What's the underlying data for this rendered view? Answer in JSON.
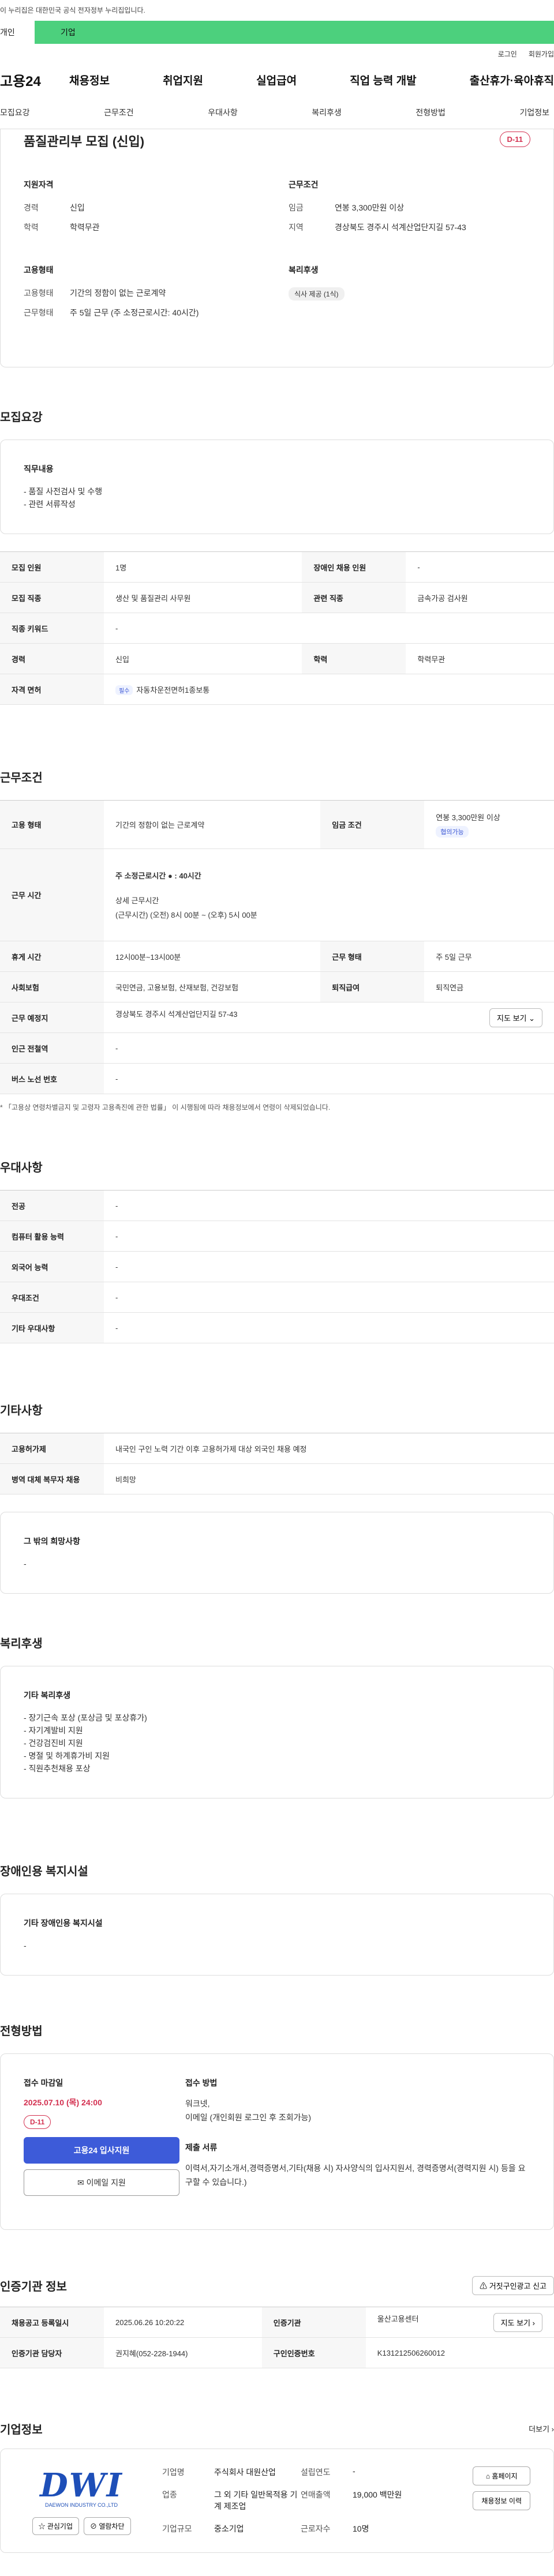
{
  "gov_banner": "이 누리집은 대한민국 공식 전자정부 누리집입니다.",
  "top_tabs": {
    "person": "개인",
    "company": "기업"
  },
  "util": {
    "login": "로그인",
    "signup": "회원가입"
  },
  "gnb": {
    "logo": "고용24",
    "menu": [
      "채용정보",
      "취업지원",
      "실업급여",
      "직업 능력 개발",
      "출산휴가·육아휴직"
    ]
  },
  "subnav": [
    "모집요강",
    "근무조건",
    "우대사항",
    "복리후생",
    "전형방법",
    "기업정보"
  ],
  "job": {
    "title": "품질관리부 모집 (신입)",
    "dday": "D-11",
    "qual_h": "지원자격",
    "career_k": "경력",
    "career_v": "신입",
    "edu_k": "학력",
    "edu_v": "학력무관",
    "cond_h": "근무조건",
    "wage_k": "임금",
    "wage_v": "연봉 3,300만원 이상",
    "region_k": "지역",
    "region_v": "경상북도 경주시 석계산업단지길 57-43",
    "emp_h": "고용형태",
    "type_k": "고용형태",
    "type_v": "기간의 정함이 없는 근로계약",
    "hours_k": "근무형태",
    "hours_v": "주 5일 근무 (주 소정근로시간: 40시간)",
    "welfare_h": "복리후생",
    "welfare_chip": "식사 제공 (1식)"
  },
  "recruit": {
    "h": "모집요강",
    "duty_h": "직무내용",
    "duty_lines": [
      "- 품질 사전검사 및 수행",
      "- 관련 서류작성"
    ],
    "rows": [
      [
        "모집 인원",
        "1명",
        "장애인 채용 인원",
        "-"
      ],
      [
        "모집 직종",
        "생산 및 품질관리 사무원",
        "관련 직종",
        "금속가공 검사원"
      ],
      [
        "직종 키워드",
        "-",
        "",
        ""
      ],
      [
        "경력",
        "신입",
        "학력",
        "학력무관"
      ]
    ],
    "license_k": "자격 면허",
    "license_badge": "필수",
    "license_v": "자동차운전면허1종보통"
  },
  "conditions": {
    "h": "근무조건",
    "emp_k": "고용 형태",
    "emp_v": "기간의 정함이 없는 근로계약",
    "wage_k": "임금 조건",
    "wage_v": "연봉 3,300만원 이상",
    "wage_badge": "협의가능",
    "time_k": "근무 시간",
    "time_main": "주 소정근로시간 ● : 40시간",
    "time_detail_h": "상세 근무시간",
    "time_detail": "(근무시간) (오전) 8시 00분 ~ (오후) 5시 00분",
    "rest_k": "휴게 시간",
    "rest_v": "12시00분~13시00분",
    "form_k": "근무 형태",
    "form_v": "주 5일 근무",
    "ins_k": "사회보험",
    "ins_v": "국민연금, 고용보험, 산재보험, 건강보험",
    "sev_k": "퇴직급여",
    "sev_v": "퇴직연금",
    "loc_k": "근무 예정지",
    "loc_v": "경상북도 경주시 석계산업단지길 57-43",
    "map_btn": "지도 보기 ⌄",
    "sub_k": "인근 전철역",
    "sub_v": "-",
    "bus_k": "버스 노선 번호",
    "bus_v": "-",
    "note": "* 「고용상 연령차별금지 및 고령자 고용촉진에 관한 법률」 이 시행됨에 따라 채용정보에서 연령이 삭제되었습니다."
  },
  "pref": {
    "h": "우대사항",
    "rows": [
      [
        "전공",
        "-"
      ],
      [
        "컴퓨터 활용 능력",
        "-"
      ],
      [
        "외국어 능력",
        "-"
      ],
      [
        "우대조건",
        "-"
      ],
      [
        "기타 우대사항",
        "-"
      ]
    ]
  },
  "etc": {
    "h": "기타사항",
    "rows": [
      [
        "고용허가제",
        "내국인 구인 노력 기간 이후 고용허가제 대상 외국인 채용 예정"
      ],
      [
        "병역 대체 복무자 채용",
        "비희망"
      ]
    ],
    "other_h": "그 밖의 희망사항",
    "other_v": "-"
  },
  "welfare": {
    "h": "복리후생",
    "box_h": "기타 복리후생",
    "lines": [
      "- 장기근속 포상 (포상금 및 포상휴가)",
      "- 자기계발비 지원",
      "- 건강검진비 지원",
      "- 명절 및 하계휴가비 지원",
      "- 직원추천채용 포상"
    ]
  },
  "disabled": {
    "h": "장애인용 복지시설",
    "box_h": "기타 장애인용 복지시설",
    "v": "-"
  },
  "apply": {
    "h": "전형방법",
    "deadline_h": "접수 마감일",
    "deadline": "2025.07.10 (목) 24:00",
    "dday": "D-11",
    "btn_apply": "고용24 입사지원",
    "btn_email": "✉ 이메일 지원",
    "method_h": "접수 방법",
    "method": "워크넷,",
    "method2": "이메일 (개인회원 로그인 후 조회가능)",
    "docs_h": "제출 서류",
    "docs": "이력서,자기소개서,경력증명서,기타(채용 시) 자사양식의 입사지원서, 경력증명서(경력지원 시) 등을 요구할 수 있습니다.)"
  },
  "cert": {
    "h": "인증기관 정보",
    "report_btn": "⚠ 거짓구인광고 신고",
    "reg_k": "채용공고 등록일시",
    "reg_v": "2025.06.26 10:20:22",
    "org_k": "인증기관",
    "org_v": "울산고용센터",
    "map_btn": "지도 보기 ›",
    "mgr_k": "인증기관 담당자",
    "mgr_v": "권지혜(052-228-1944)",
    "no_k": "구인인증번호",
    "no_v": "K131212506260012"
  },
  "company": {
    "h": "기업정보",
    "more": "더보기 ›",
    "logo_text": "DWI",
    "logo_sub": "DAEWON INDUSTRY CO.,LTD",
    "fav_btn": "☆ 관심기업",
    "block_btn": "⊘ 열람차단",
    "name_k": "기업명",
    "name_v": "주식회사 대원산업",
    "est_k": "설립연도",
    "est_v": "-",
    "ind_k": "업종",
    "ind_v": "그 외 기타 일반목적용 기계 제조업",
    "sales_k": "연매출액",
    "sales_v": "19,000 백만원",
    "scale_k": "기업규모",
    "scale_v": "중소기업",
    "staff_k": "근로자수",
    "staff_v": "10명",
    "home_btn": "⌂ 홈페이지",
    "jobs_btn": "채용정보 이력"
  }
}
